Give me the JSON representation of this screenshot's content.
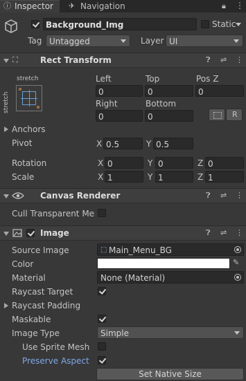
{
  "tabs": {
    "inspector": "Inspector",
    "navigation": "Navigation"
  },
  "object": {
    "name": "Background_Img",
    "static_label": "Static",
    "tag_label": "Tag",
    "tag_value": "Untagged",
    "layer_label": "Layer",
    "layer_value": "UI"
  },
  "rect_transform": {
    "title": "Rect Transform",
    "anchor_h": "stretch",
    "anchor_v": "stretch",
    "left_label": "Left",
    "left_value": "0",
    "top_label": "Top",
    "top_value": "0",
    "posz_label": "Pos Z",
    "posz_value": "0",
    "right_label": "Right",
    "right_value": "0",
    "bottom_label": "Bottom",
    "bottom_value": "0",
    "r_button": "R",
    "anchors_label": "Anchors",
    "pivot_label": "Pivot",
    "pivot_x": "0.5",
    "pivot_y": "0.5",
    "rotation_label": "Rotation",
    "rot_x": "0",
    "rot_y": "0",
    "rot_z": "0",
    "scale_label": "Scale",
    "scale_x": "1",
    "scale_y": "1",
    "scale_z": "1",
    "x": "X",
    "y": "Y",
    "z": "Z"
  },
  "canvas_renderer": {
    "title": "Canvas Renderer",
    "cull_label": "Cull Transparent Mes"
  },
  "image": {
    "title": "Image",
    "source_label": "Source Image",
    "source_value": "Main_Menu_BG",
    "color_label": "Color",
    "color_value": "#ffffff",
    "material_label": "Material",
    "material_value": "None (Material)",
    "raycast_target_label": "Raycast Target",
    "raycast_padding_label": "Raycast Padding",
    "maskable_label": "Maskable",
    "image_type_label": "Image Type",
    "image_type_value": "Simple",
    "use_sprite_mesh_label": "Use Sprite Mesh",
    "preserve_aspect_label": "Preserve Aspect",
    "set_native_size": "Set Native Size"
  },
  "icons": [
    "inspector-icon",
    "navigation-icon",
    "lock-icon",
    "menu-icon",
    "cube-icon",
    "help-icon",
    "preset-icon",
    "kebab-icon",
    "eye-icon",
    "image-component-icon",
    "object-picker-icon",
    "eyedropper-icon",
    "rect-transform-icon"
  ]
}
